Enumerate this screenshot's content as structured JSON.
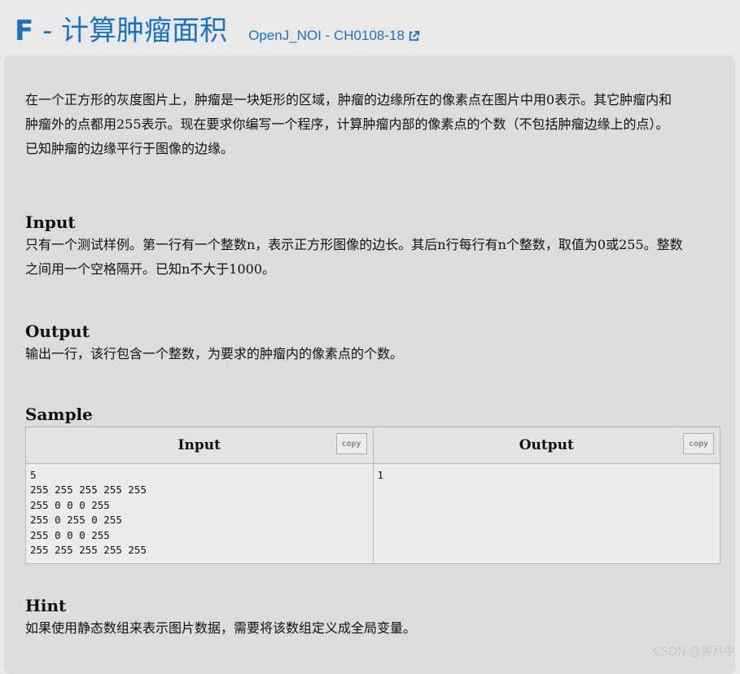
{
  "header": {
    "letter": "F",
    "separator": " - ",
    "title": "计算肿瘤面积",
    "source_link": "OpenJ_NOI - CH0108-18",
    "source_icon": "external-link-icon"
  },
  "description": [
    "在一个正方形的灰度图片上，肿瘤是一块矩形的区域，肿瘤的边缘所在的像素点在图片中用0表示。其它肿瘤内和",
    "肿瘤外的点都用255表示。现在要求你编写一个程序，计算肿瘤内部的像素点的个数（不包括肿瘤边缘上的点）。",
    "已知肿瘤的边缘平行于图像的边缘。"
  ],
  "input": {
    "title": "Input",
    "lines": [
      "只有一个测试样例。第一行有一个整数n，表示正方形图像的边长。其后n行每行有n个整数，取值为0或255。整数",
      "之间用一个空格隔开。已知n不大于1000。"
    ]
  },
  "output": {
    "title": "Output",
    "lines": [
      "输出一行，该行包含一个整数，为要求的肿瘤内的像素点的个数。"
    ]
  },
  "sample": {
    "title": "Sample",
    "input_header": "Input",
    "output_header": "Output",
    "copy_label": "copy",
    "input_text": "5\n255 255 255 255 255\n255 0 0 0 255\n255 0 255 0 255\n255 0 0 0 255\n255 255 255 255 255",
    "output_text": "1"
  },
  "hint": {
    "title": "Hint",
    "text": "如果使用静态数组来表示图片数据，需要将该数组定义成全局变量。"
  },
  "watermark": "CSDN @霁月中",
  "colors": {
    "accent": "#1a73c2",
    "page_bg": "#e9e9e9",
    "panel_bg": "#dcdcdc"
  }
}
